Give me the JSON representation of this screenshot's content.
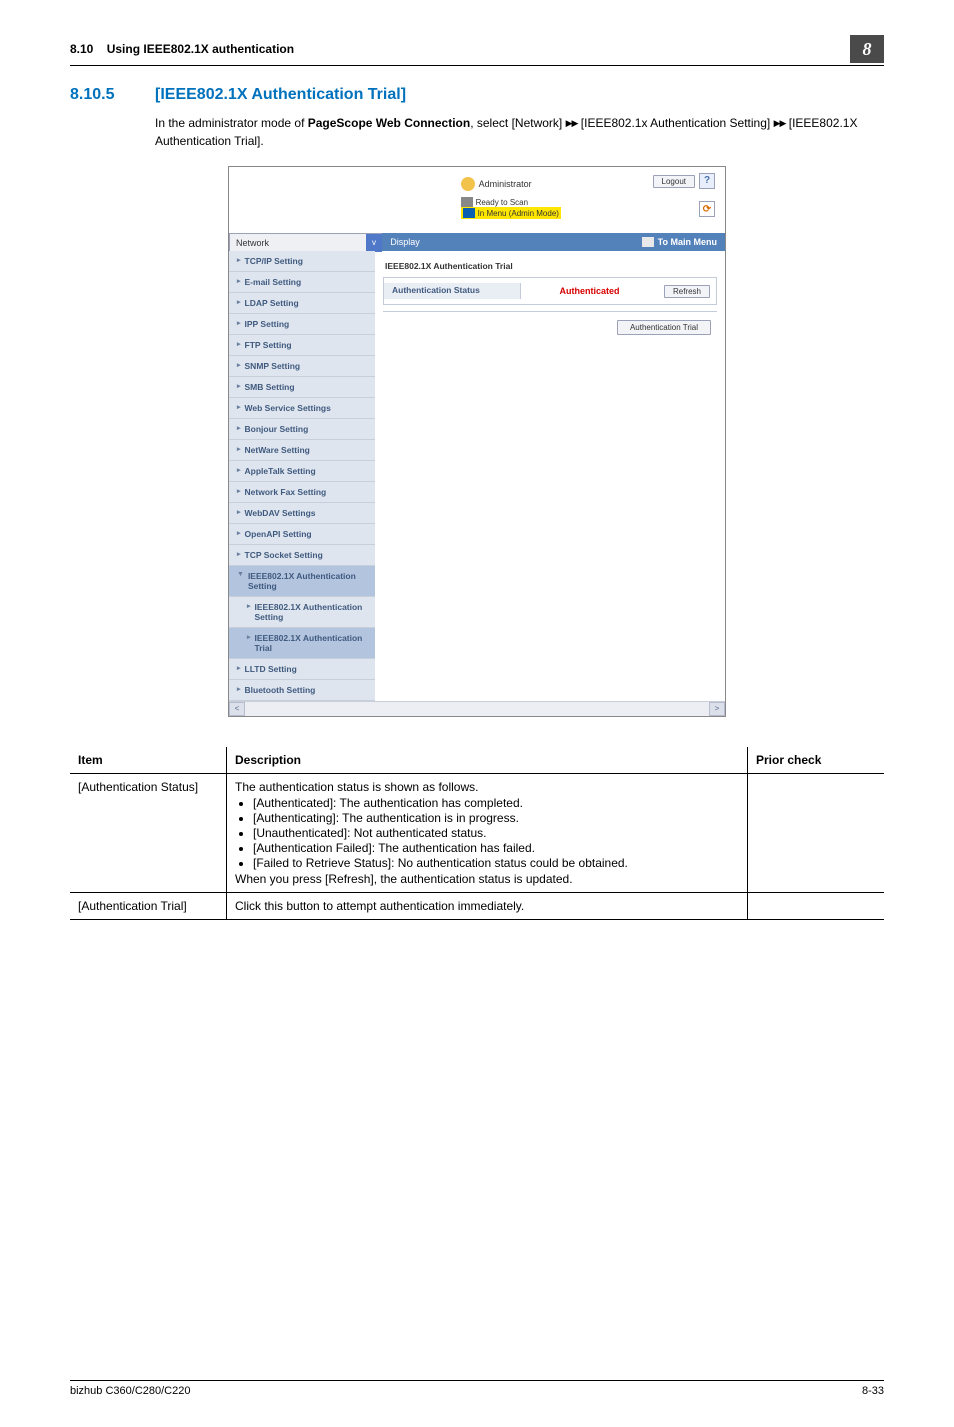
{
  "header": {
    "section_no": "8.10",
    "section_title": "Using IEEE802.1X authentication",
    "chapter_badge": "8"
  },
  "section": {
    "number": "8.10.5",
    "title": "[IEEE802.1X Authentication Trial]",
    "intro_pre": "In the administrator mode of ",
    "intro_bold": "PageScope Web Connection",
    "intro_mid": ", select [Network] ",
    "intro_path2": " [IEEE802.1x Authentication Setting] ",
    "intro_path3": " [IEEE802.1X Authentication Trial]."
  },
  "app": {
    "role": "Administrator",
    "status1": "Ready to Scan",
    "status2": "In Menu (Admin Mode)",
    "logout": "Logout",
    "help": "?",
    "category": "Network",
    "display_btn": "Display",
    "to_main": "To Main Menu",
    "nav": {
      "i0": "TCP/IP Setting",
      "i1": "E-mail Setting",
      "i2": "LDAP Setting",
      "i3": "IPP Setting",
      "i4": "FTP Setting",
      "i5": "SNMP Setting",
      "i6": "SMB Setting",
      "i7": "Web Service Settings",
      "i8": "Bonjour Setting",
      "i9": "NetWare Setting",
      "i10": "AppleTalk Setting",
      "i11": "Network Fax Setting",
      "i12": "WebDAV Settings",
      "i13": "OpenAPI Setting",
      "i14": "TCP Socket Setting",
      "i15": "IEEE802.1X Authentication Setting",
      "i15a": "IEEE802.1X Authentication Setting",
      "i15b": "IEEE802.1X Authentication Trial",
      "i16": "LLTD Setting",
      "i17": "Bluetooth Setting"
    },
    "panel": {
      "title": "IEEE802.1X Authentication Trial",
      "status_label": "Authentication Status",
      "status_value": "Authenticated",
      "refresh": "Refresh",
      "trial_btn": "Authentication Trial"
    }
  },
  "table": {
    "h1": "Item",
    "h2": "Description",
    "h3": "Prior check",
    "r1c1": "[Authentication Status]",
    "r1_intro": "The authentication status is shown as follows.",
    "r1_b1": "[Authenticated]: The authentication has completed.",
    "r1_b2": "[Authenticating]: The authentication is in progress.",
    "r1_b3": "[Unauthenticated]: Not authenticated status.",
    "r1_b4": "[Authentication Failed]: The authentication has failed.",
    "r1_b5": "[Failed to Retrieve Status]: No authentication status could be obtained.",
    "r1_after": "When you press [Refresh], the authentication status is updated.",
    "r2c1": "[Authentication Trial]",
    "r2c2": "Click this button to attempt authentication immediately."
  },
  "footer": {
    "left": "bizhub C360/C280/C220",
    "right": "8-33"
  }
}
